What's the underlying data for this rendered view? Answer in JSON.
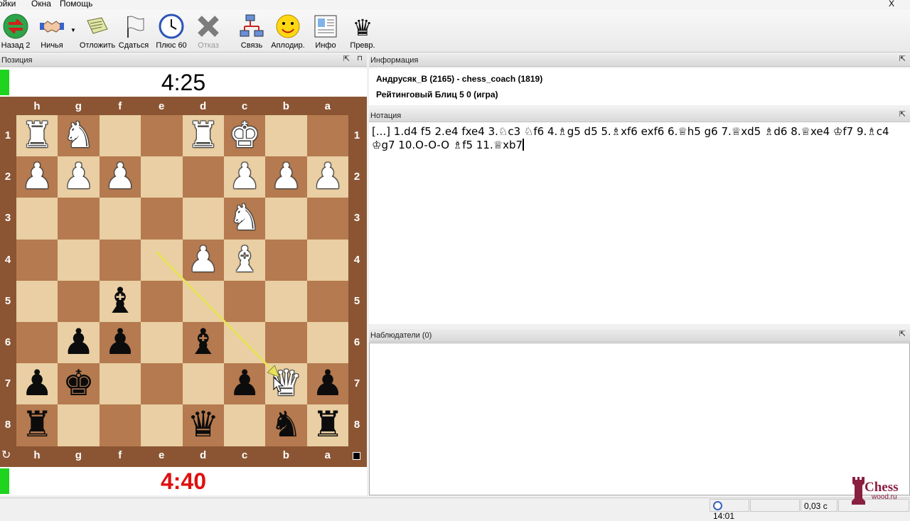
{
  "menu": {
    "items": [
      "ойки",
      "Окна",
      "Помощь"
    ],
    "close": "X"
  },
  "toolbar": {
    "buttons": [
      {
        "label": "Назад 2",
        "icon": "back-arrows-icon"
      },
      {
        "label": "Ничья",
        "icon": "handshake-icon"
      },
      {
        "label": "Отложить",
        "icon": "adjourn-icon"
      },
      {
        "label": "Сдаться",
        "icon": "white-flag-icon"
      },
      {
        "label": "Плюс 60",
        "icon": "clock-icon"
      },
      {
        "label": "Отказ",
        "icon": "cross-icon"
      },
      {
        "label": "Связь",
        "icon": "network-icon"
      },
      {
        "label": "Аплодир.",
        "icon": "smiley-icon"
      },
      {
        "label": "Инфо",
        "icon": "info-icon"
      },
      {
        "label": "Превр.",
        "icon": "queen-icon"
      }
    ]
  },
  "position_panel": {
    "title": "Позиция",
    "clock_top": "4:25",
    "clock_bottom": "4:40",
    "pin": "⇱"
  },
  "board": {
    "files": [
      "h",
      "g",
      "f",
      "e",
      "d",
      "c",
      "b",
      "a"
    ],
    "ranks": [
      "1",
      "2",
      "3",
      "4",
      "5",
      "6",
      "7",
      "8"
    ],
    "light_color": "#e9cfa3",
    "dark_color": "#b57a4f",
    "pieces": [
      {
        "square": "h1",
        "piece": "R",
        "color": "white"
      },
      {
        "square": "g1",
        "piece": "N",
        "color": "white"
      },
      {
        "square": "d1",
        "piece": "R",
        "color": "white"
      },
      {
        "square": "c1",
        "piece": "K",
        "color": "white"
      },
      {
        "square": "h2",
        "piece": "P",
        "color": "white"
      },
      {
        "square": "g2",
        "piece": "P",
        "color": "white"
      },
      {
        "square": "f2",
        "piece": "P",
        "color": "white"
      },
      {
        "square": "c2",
        "piece": "P",
        "color": "white"
      },
      {
        "square": "b2",
        "piece": "P",
        "color": "white"
      },
      {
        "square": "a2",
        "piece": "P",
        "color": "white"
      },
      {
        "square": "c3",
        "piece": "N",
        "color": "white"
      },
      {
        "square": "d4",
        "piece": "P",
        "color": "white"
      },
      {
        "square": "c4",
        "piece": "B",
        "color": "white"
      },
      {
        "square": "b7",
        "piece": "Q",
        "color": "white"
      },
      {
        "square": "f5",
        "piece": "B",
        "color": "black"
      },
      {
        "square": "g6",
        "piece": "P",
        "color": "black"
      },
      {
        "square": "f6",
        "piece": "P",
        "color": "black"
      },
      {
        "square": "d6",
        "piece": "B",
        "color": "black"
      },
      {
        "square": "h7",
        "piece": "P",
        "color": "black"
      },
      {
        "square": "g7",
        "piece": "K",
        "color": "black"
      },
      {
        "square": "c7",
        "piece": "P",
        "color": "black"
      },
      {
        "square": "a7",
        "piece": "P",
        "color": "black"
      },
      {
        "square": "h8",
        "piece": "R",
        "color": "black"
      },
      {
        "square": "d8",
        "piece": "Q",
        "color": "black"
      },
      {
        "square": "b8",
        "piece": "N",
        "color": "black"
      },
      {
        "square": "a8",
        "piece": "R",
        "color": "black"
      }
    ],
    "last_move_from": "e4",
    "last_move_to": "b7",
    "arrow_color": "#e7e25a"
  },
  "info_panel": {
    "title": "Информация",
    "players": "Андрусяк_В (2165) - chess_coach (1819)",
    "game_type": "Рейтинговый Блиц 5 0  (игра)"
  },
  "notation_panel": {
    "title": "Нотация",
    "text": "[...] 1.d4 f5 2.e4 fxe4 3.♘c3 ♘f6 4.♗g5 d5 5.♗xf6 exf6 6.♕h5 g6 7.♕xd5 ♗d6 8.♕xe4 ♔f7 9.♗c4 ♔g7 10.O-O-O ♗f5 11.♕xb7"
  },
  "observers_panel": {
    "title": "Наблюдатели (0)"
  },
  "statusbar": {
    "time": "14:01",
    "lag": "0,03 с"
  },
  "logo": {
    "text": "Chess",
    "subtext": "wood.ru"
  }
}
